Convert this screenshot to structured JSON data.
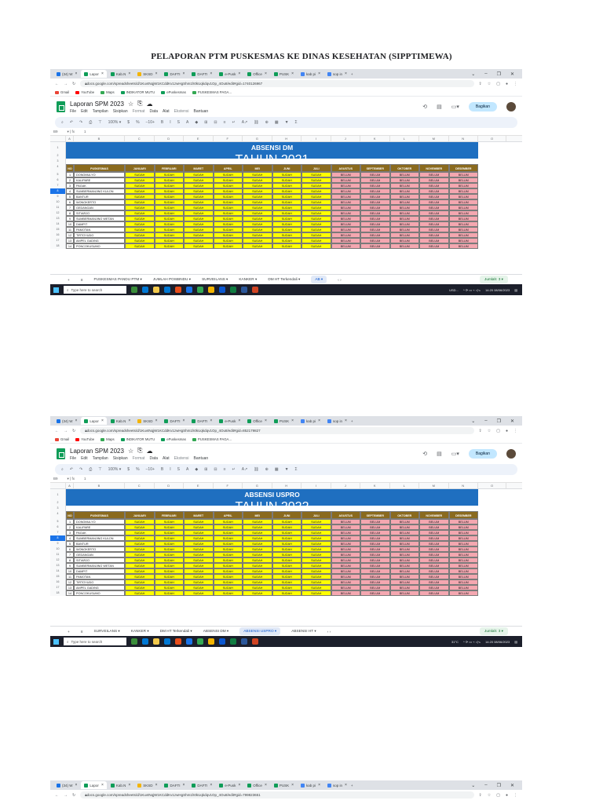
{
  "document_title": "PELAPORAN PTM PUSKESMAS KE DINAS KESEHATAN (SIPPTIMEWA)",
  "browser": {
    "tabs": [
      {
        "label": "(34) W",
        "color": "#1a73e8"
      },
      {
        "label": "Lapor",
        "color": "#0f9d58"
      },
      {
        "label": "Kab.N",
        "color": "#0f9d58"
      },
      {
        "label": "SKSD",
        "color": "#f4b400"
      },
      {
        "label": "DAFTI",
        "color": "#0f9d58"
      },
      {
        "label": "DAFTI",
        "color": "#0f9d58"
      },
      {
        "label": "e-Pusk",
        "color": "#0f9d58"
      },
      {
        "label": "Office",
        "color": "#0f9d58"
      },
      {
        "label": "PUSK",
        "color": "#0f9d58"
      },
      {
        "label": "kab pi",
        "color": "#4285f4"
      },
      {
        "label": "sop in",
        "color": "#4285f4"
      }
    ],
    "new_tab": "+",
    "urls": [
      "docs.google.com/spreadsheets/d/1KuvtNqjW1KCddKv1zwHgShm1h0kUqkdqv1Op_4Ou8/edit#gid=1740126967",
      "docs.google.com/spreadsheets/d/1KuvtNqjW1KCddKv1zwHgShm1h0kUqkdqv1Op_4Ou8/edit#gid=852179827",
      "docs.google.com/spreadsheets/d/1KuvtNqjW1KCddKv1zwHgShm1h0kUqkdqv1Op_4Ou8/edit#gid=799823651"
    ],
    "bookmarks": [
      {
        "label": "Gmail",
        "color": "#ea4335"
      },
      {
        "label": "YouTube",
        "color": "#ff0000"
      },
      {
        "label": "Maps",
        "color": "#34a853"
      },
      {
        "label": "INDIKATOR MUTU",
        "color": "#0f9d58"
      },
      {
        "label": "ePuskesmas",
        "color": "#0f9d58"
      },
      {
        "label": "PUSKESMAS PAGA...",
        "color": "#34a853"
      }
    ]
  },
  "sheets_app": {
    "doc_name": "Laporan SPM 2023",
    "menu": [
      "File",
      "Edit",
      "Tampilan",
      "Sisipkan",
      "Format",
      "Data",
      "Alat",
      "Ekstensi",
      "Bantuan"
    ],
    "share_label": "Bagikan",
    "zoom": "100%",
    "cell_ref": "B9",
    "fx": "fx",
    "formula": "1"
  },
  "table": {
    "headers": [
      "NO",
      "PUSKESMAS",
      "JANUARI",
      "FEBRUARI",
      "MARET",
      "APRIL",
      "MEI",
      "JUNI",
      "JULI",
      "AGUSTUS",
      "SEPTEMBER",
      "OKTOBER",
      "NOVEMBER",
      "DESEMBER"
    ],
    "columns": [
      "A",
      "B",
      "C",
      "D",
      "E",
      "F",
      "G",
      "H",
      "I",
      "J",
      "K",
      "L",
      "M",
      "N",
      "O"
    ],
    "status_done": "SUDAH",
    "status_not": "BELUM",
    "done_months": 7,
    "rows": [
      {
        "no": "1",
        "name": "DONOMULYO"
      },
      {
        "no": "2",
        "name": "KALIPARE"
      },
      {
        "no": "3",
        "name": "PAGAK"
      },
      {
        "no": "4",
        "name": "SUMBERMANJING KULON"
      },
      {
        "no": "5",
        "name": "BANTUR"
      },
      {
        "no": "6",
        "name": "WONOKERTO"
      },
      {
        "no": "7",
        "name": "GEDANGAN"
      },
      {
        "no": "8",
        "name": "SITIARJO"
      },
      {
        "no": "9",
        "name": "SUMBERMANJING WETAN"
      },
      {
        "no": "10",
        "name": "DAMPIT"
      },
      {
        "no": "11",
        "name": "PAMOTAN"
      },
      {
        "no": "12",
        "name": "TIRTOYUDO"
      },
      {
        "no": "13",
        "name": "AMPEL GADING"
      },
      {
        "no": "14",
        "name": "PONCOKUSUMO"
      }
    ]
  },
  "screenshots": [
    {
      "banner_title": "ABSENSI DM",
      "banner_year": "TAHUN 2021",
      "sheet_tabs": [
        "PUSKESMAS PANDU PTM",
        "JUMLAH POSBINDU",
        "SURVEILANS",
        "KANKER",
        "DM HT Terkendali",
        "AB"
      ],
      "active_tab": 5,
      "explore": "Jumlah: 3",
      "tray_time": "14:20",
      "tray_date": "08/06/2023",
      "weather": "USD..."
    },
    {
      "banner_title": "ABSENSI USPRO",
      "banner_year": "TAHUN 2022",
      "sheet_tabs": [
        "SURVEILANS",
        "KANKER",
        "DM HT Terkendali",
        "ABSENSI DM",
        "ABSENSI USPRO",
        "ABSENSI HT"
      ],
      "active_tab": 4,
      "explore": "Jumlah: 3",
      "tray_time": "14:20",
      "tray_date": "08/06/2023",
      "weather": "31°C"
    }
  ],
  "taskbar": {
    "search_placeholder": "Type here to search"
  }
}
